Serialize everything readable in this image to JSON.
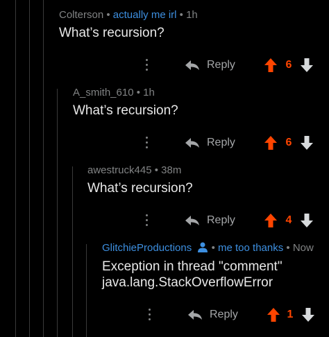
{
  "comments": [
    {
      "author": "Colterson",
      "flair": "actually me irl",
      "time": "1h",
      "body": [
        "What’s recursion?"
      ],
      "reply_label": "Reply",
      "score": "6"
    },
    {
      "author": "A_smith_610",
      "time": "1h",
      "body": [
        "What’s recursion?"
      ],
      "reply_label": "Reply",
      "score": "6"
    },
    {
      "author": "awestruck445",
      "time": "38m",
      "body": [
        "What’s recursion?"
      ],
      "reply_label": "Reply",
      "score": "4"
    },
    {
      "author": "GlitchieProductions",
      "flair": "me too thanks",
      "time": "Now",
      "body": [
        "Exception in thread \"comment\"",
        "java.lang.StackOverflowError"
      ],
      "reply_label": "Reply",
      "score": "1"
    }
  ],
  "colors": {
    "background": "#000000",
    "upvote": "#ff4500",
    "flair": "#3d8fe0",
    "thread_line": "#3a3a3a"
  },
  "icons": {
    "more": "more-vertical-icon",
    "reply": "reply-arrow-icon",
    "upvote": "upvote-arrow-icon",
    "downvote": "downvote-arrow-icon",
    "user": "user-profile-icon",
    "upvote_state": "active"
  }
}
